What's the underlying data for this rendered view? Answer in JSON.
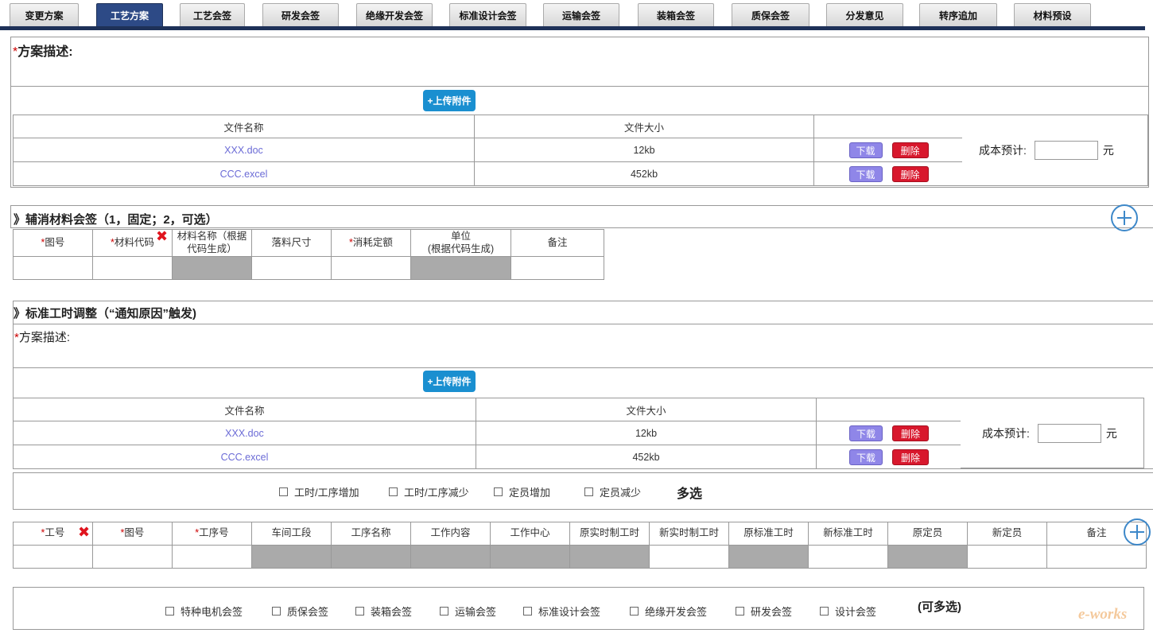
{
  "tabs": [
    {
      "label": "变更方案",
      "active": false
    },
    {
      "label": "工艺方案",
      "active": true
    },
    {
      "label": "工艺会签",
      "active": false
    },
    {
      "label": "研发会签",
      "active": false
    },
    {
      "label": "绝缘开发会签",
      "active": false
    },
    {
      "label": "标准设计会签",
      "active": false
    },
    {
      "label": "运输会签",
      "active": false
    },
    {
      "label": "装箱会签",
      "active": false
    },
    {
      "label": "质保会签",
      "active": false
    },
    {
      "label": "分发意见",
      "active": false
    },
    {
      "label": "转序追加",
      "active": false
    },
    {
      "label": "材料预设",
      "active": false
    }
  ],
  "plan": {
    "required_mark": "*",
    "title": "方案描述:",
    "upload_label": "+上传附件",
    "file_header": {
      "name": "文件名称",
      "size": "文件大小"
    },
    "files": [
      {
        "name": "XXX.doc",
        "size": "12kb"
      },
      {
        "name": "CCC.excel",
        "size": "452kb"
      }
    ],
    "download_label": "下载",
    "delete_label": "删除",
    "cost_label": "成本预计:",
    "cost_unit": "元"
  },
  "materials": {
    "title": "》辅消材料会签（1，固定；2，可选）",
    "required_mark": "*",
    "columns": [
      {
        "label": "图号",
        "required": true
      },
      {
        "label": "材料代码",
        "required": true
      },
      {
        "label": "材料名称（根据代码生成）",
        "required": false
      },
      {
        "label": "落料尺寸",
        "required": false
      },
      {
        "label": "消耗定额",
        "required": true
      },
      {
        "label": "单位\n(根据代码生成)",
        "required": false
      },
      {
        "label": "备注",
        "required": false
      }
    ]
  },
  "labor": {
    "title": "》标准工时调整（“通知原因”触发)",
    "required_mark": "*",
    "desc_label": "方案描述:",
    "upload_label": "+上传附件",
    "file_header": {
      "name": "文件名称",
      "size": "文件大小"
    },
    "files": [
      {
        "name": "XXX.doc",
        "size": "12kb"
      },
      {
        "name": "CCC.excel",
        "size": "452kb"
      }
    ],
    "download_label": "下载",
    "delete_label": "删除",
    "cost_label": "成本预计:",
    "cost_unit": "元",
    "options": [
      "工时/工序增加",
      "工时/工序减少",
      "定员增加",
      "定员减少"
    ],
    "options_note": "多选",
    "columns": [
      {
        "label": "工号",
        "required": true
      },
      {
        "label": "图号",
        "required": true
      },
      {
        "label": "工序号",
        "required": true
      },
      {
        "label": "车间工段",
        "required": false
      },
      {
        "label": "工序名称",
        "required": false
      },
      {
        "label": "工作内容",
        "required": false
      },
      {
        "label": "工作中心",
        "required": false
      },
      {
        "label": "原实时制工时",
        "required": false
      },
      {
        "label": "新实时制工时",
        "required": false
      },
      {
        "label": "原标准工时",
        "required": false
      },
      {
        "label": "新标准工时",
        "required": false
      },
      {
        "label": "原定员",
        "required": false
      },
      {
        "label": "新定员",
        "required": false
      },
      {
        "label": "备注",
        "required": false
      }
    ]
  },
  "signoff": {
    "options": [
      "特种电机会签",
      "质保会签",
      "装箱会签",
      "运输会签",
      "标准设计会签",
      "绝缘开发会签",
      "研发会签",
      "设计会签"
    ],
    "note": "(可多选)"
  },
  "watermark": "e-works"
}
